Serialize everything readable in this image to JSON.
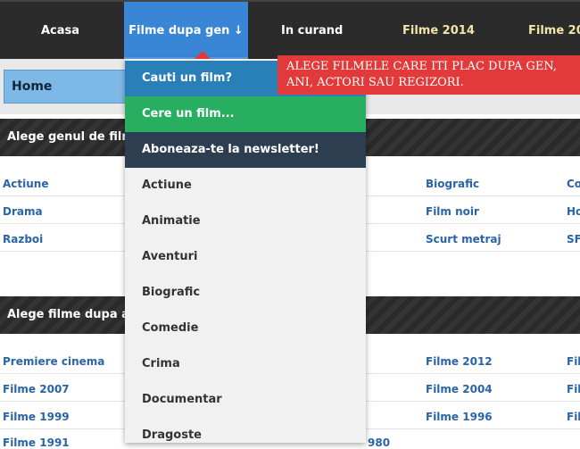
{
  "nav": {
    "items": [
      {
        "label": "Acasa"
      },
      {
        "label": "Filme dupa gen ↓"
      },
      {
        "label": "In curand"
      },
      {
        "label": "Filme 2014"
      },
      {
        "label": "Filme 20"
      }
    ]
  },
  "breadcrumb": {
    "home": "Home"
  },
  "sections": {
    "genre_title": "Alege genul de film",
    "year_title": "Alege filme dupa a"
  },
  "genre_grid": {
    "col1": [
      "Actiune",
      "Drama",
      "Razboi"
    ],
    "col3": [
      "Biografic",
      "Film noir",
      "Scurt metraj"
    ],
    "col4": [
      "Co",
      "Ho",
      "SF"
    ]
  },
  "year_grid": {
    "col1": [
      "Premiere cinema",
      "Filme 2007",
      "Filme 1999",
      "Filme 1991"
    ],
    "col3": [
      "Filme 2012",
      "Filme 2004",
      "Filme 1996"
    ],
    "col4": [
      "Fil",
      "Fil",
      "Fil"
    ],
    "partial": "980"
  },
  "dropdown": {
    "special": [
      {
        "label": "Cauti un film?",
        "color": "#2980b9"
      },
      {
        "label": "Cere un film...",
        "color": "#27ae60"
      },
      {
        "label": "Aboneaza-te la newsletter!",
        "color": "#2c3e50"
      }
    ],
    "genres": [
      "Actiune",
      "Animatie",
      "Aventuri",
      "Biografic",
      "Comedie",
      "Crima",
      "Documentar",
      "Dragoste"
    ]
  },
  "tooltip": {
    "line1": "ALEGE FILMELE CARE ITI PLAC DUPA GEN,",
    "line2": "ANI, ACTORI SAU REGIZORI."
  },
  "colors": {
    "active_tab": "#3a86d6",
    "tooltip": "#e23a3a",
    "link": "#2a64a8"
  }
}
